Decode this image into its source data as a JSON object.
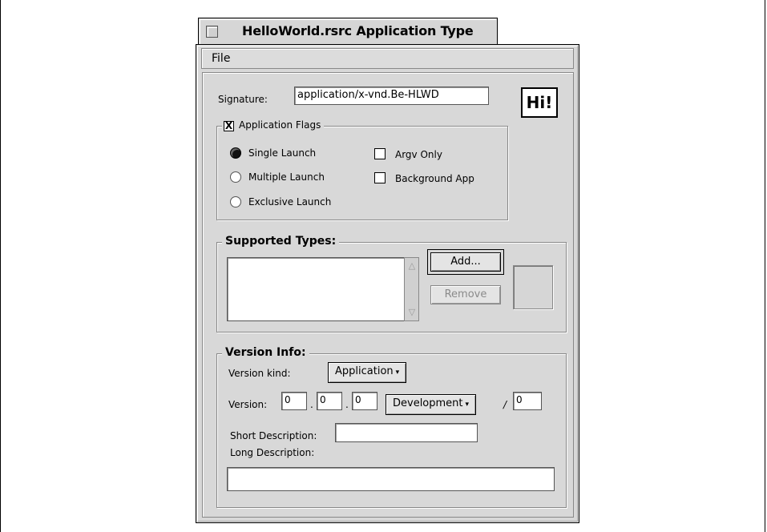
{
  "window": {
    "title": "HelloWorld.rsrc Application Type"
  },
  "menu": {
    "file": "File"
  },
  "signature": {
    "label": "Signature:",
    "value": "application/x-vnd.Be-HLWD"
  },
  "app_icon": {
    "text": "Hi!",
    "icon": "app-icon"
  },
  "app_flags": {
    "label": "Application Flags",
    "checked": "X",
    "single_launch": "Single Launch",
    "multiple_launch": "Multiple Launch",
    "exclusive_launch": "Exclusive Launch",
    "argv_only": "Argv Only",
    "background_app": "Background App"
  },
  "supported_types": {
    "label": "Supported Types:",
    "add_button": "Add...",
    "remove_button": "Remove",
    "up_arrow": "△",
    "down_arrow": "▽"
  },
  "version_info": {
    "label": "Version Info:",
    "kind_label": "Version kind:",
    "kind_value": "Application",
    "version_label": "Version:",
    "major": "0",
    "middle": "0",
    "minor": "0",
    "dot1": ".",
    "dot2": ".",
    "variety": "Development",
    "slash": "/",
    "internal": "0",
    "short_desc_label": "Short Description:",
    "short_desc_value": "",
    "long_desc_label": "Long Description:",
    "long_desc_value": ""
  },
  "popup_caret": "▾"
}
